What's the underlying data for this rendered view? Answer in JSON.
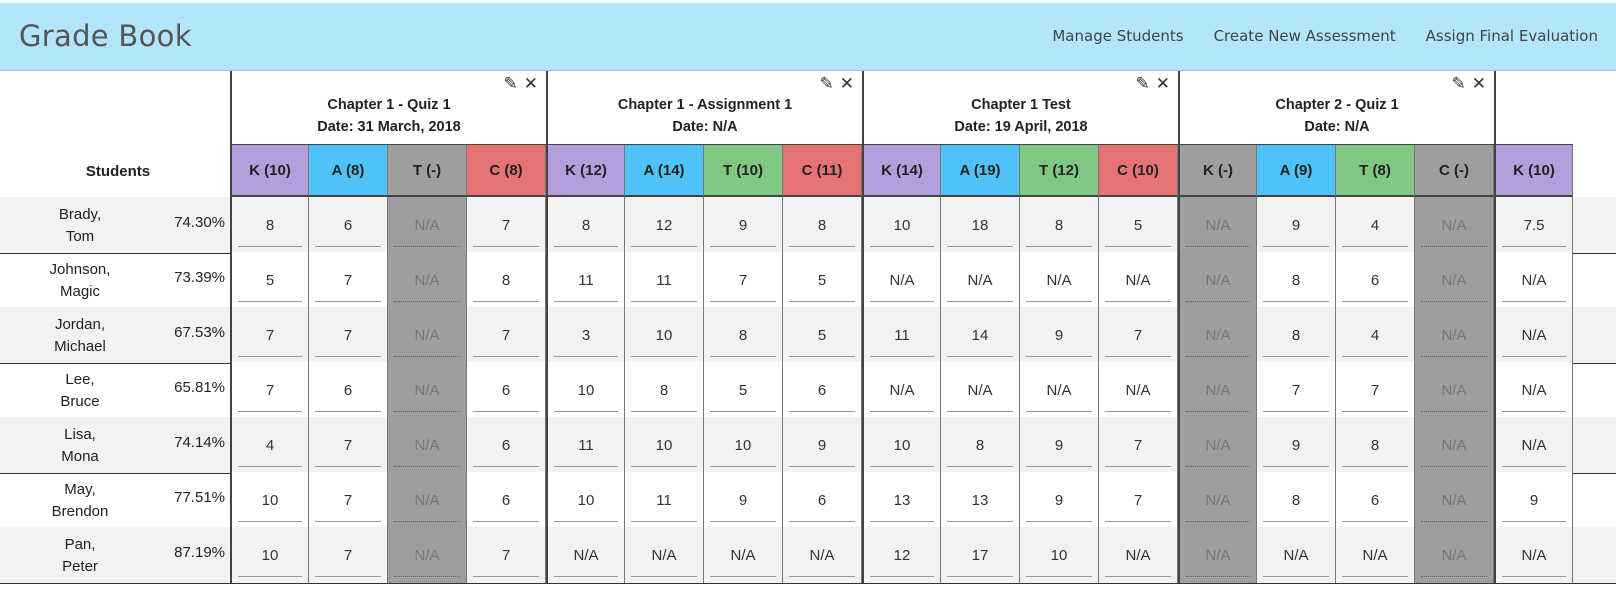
{
  "app": {
    "title": "Grade Book",
    "nav": [
      "Manage Students",
      "Create New Assessment",
      "Assign Final Evaluation"
    ]
  },
  "students_header": "Students",
  "colors": {
    "K": "#b39ddb",
    "A": "#4fc3f7",
    "T": "#81c784",
    "C": "#e57373",
    "disabled": "#9e9e9e"
  },
  "assessments": [
    {
      "name": "Chapter 1 - Quiz 1",
      "date": "Date: 31 March, 2018",
      "columns": [
        {
          "label": "K (10)",
          "cat": "K"
        },
        {
          "label": "A (8)",
          "cat": "A"
        },
        {
          "label": "T (-)",
          "cat": "disabled"
        },
        {
          "label": "C (8)",
          "cat": "C"
        }
      ]
    },
    {
      "name": "Chapter 1 - Assignment 1",
      "date": "Date: N/A",
      "columns": [
        {
          "label": "K (12)",
          "cat": "K"
        },
        {
          "label": "A (14)",
          "cat": "A"
        },
        {
          "label": "T (10)",
          "cat": "T"
        },
        {
          "label": "C (11)",
          "cat": "C"
        }
      ]
    },
    {
      "name": "Chapter 1 Test",
      "date": "Date: 19 April, 2018",
      "columns": [
        {
          "label": "K (14)",
          "cat": "K"
        },
        {
          "label": "A (19)",
          "cat": "A"
        },
        {
          "label": "T (12)",
          "cat": "T"
        },
        {
          "label": "C (10)",
          "cat": "C"
        }
      ]
    },
    {
      "name": "Chapter 2 - Quiz 1",
      "date": "Date: N/A",
      "columns": [
        {
          "label": "K (-)",
          "cat": "disabled"
        },
        {
          "label": "A (9)",
          "cat": "A"
        },
        {
          "label": "T (8)",
          "cat": "T"
        },
        {
          "label": "C (-)",
          "cat": "disabled"
        }
      ]
    },
    {
      "name": "",
      "date": "",
      "columns": [
        {
          "label": "K (10)",
          "cat": "K"
        }
      ]
    }
  ],
  "students": [
    {
      "last": "Brady,",
      "first": "Tom",
      "pct": "74.30%",
      "grades": [
        "8",
        "6",
        "N/A",
        "7",
        "8",
        "12",
        "9",
        "8",
        "10",
        "18",
        "8",
        "5",
        "N/A",
        "9",
        "4",
        "N/A",
        "7.5"
      ]
    },
    {
      "last": "Johnson,",
      "first": "Magic",
      "pct": "73.39%",
      "grades": [
        "5",
        "7",
        "N/A",
        "8",
        "11",
        "11",
        "7",
        "5",
        "N/A",
        "N/A",
        "N/A",
        "N/A",
        "N/A",
        "8",
        "6",
        "N/A",
        "N/A"
      ]
    },
    {
      "last": "Jordan,",
      "first": "Michael",
      "pct": "67.53%",
      "grades": [
        "7",
        "7",
        "N/A",
        "7",
        "3",
        "10",
        "8",
        "5",
        "11",
        "14",
        "9",
        "7",
        "N/A",
        "8",
        "4",
        "N/A",
        "N/A"
      ]
    },
    {
      "last": "Lee,",
      "first": "Bruce",
      "pct": "65.81%",
      "grades": [
        "7",
        "6",
        "N/A",
        "6",
        "10",
        "8",
        "5",
        "6",
        "N/A",
        "N/A",
        "N/A",
        "N/A",
        "N/A",
        "7",
        "7",
        "N/A",
        "N/A"
      ]
    },
    {
      "last": "Lisa,",
      "first": "Mona",
      "pct": "74.14%",
      "grades": [
        "4",
        "7",
        "N/A",
        "6",
        "11",
        "10",
        "10",
        "9",
        "10",
        "8",
        "9",
        "7",
        "N/A",
        "9",
        "8",
        "N/A",
        "N/A"
      ]
    },
    {
      "last": "May,",
      "first": "Brendon",
      "pct": "77.51%",
      "grades": [
        "10",
        "7",
        "N/A",
        "6",
        "10",
        "11",
        "9",
        "6",
        "13",
        "13",
        "9",
        "7",
        "N/A",
        "8",
        "6",
        "N/A",
        "9"
      ]
    },
    {
      "last": "Pan,",
      "first": "Peter",
      "pct": "87.19%",
      "grades": [
        "10",
        "7",
        "N/A",
        "7",
        "N/A",
        "N/A",
        "N/A",
        "N/A",
        "12",
        "17",
        "10",
        "N/A",
        "N/A",
        "N/A",
        "N/A",
        "N/A",
        "N/A"
      ]
    }
  ]
}
